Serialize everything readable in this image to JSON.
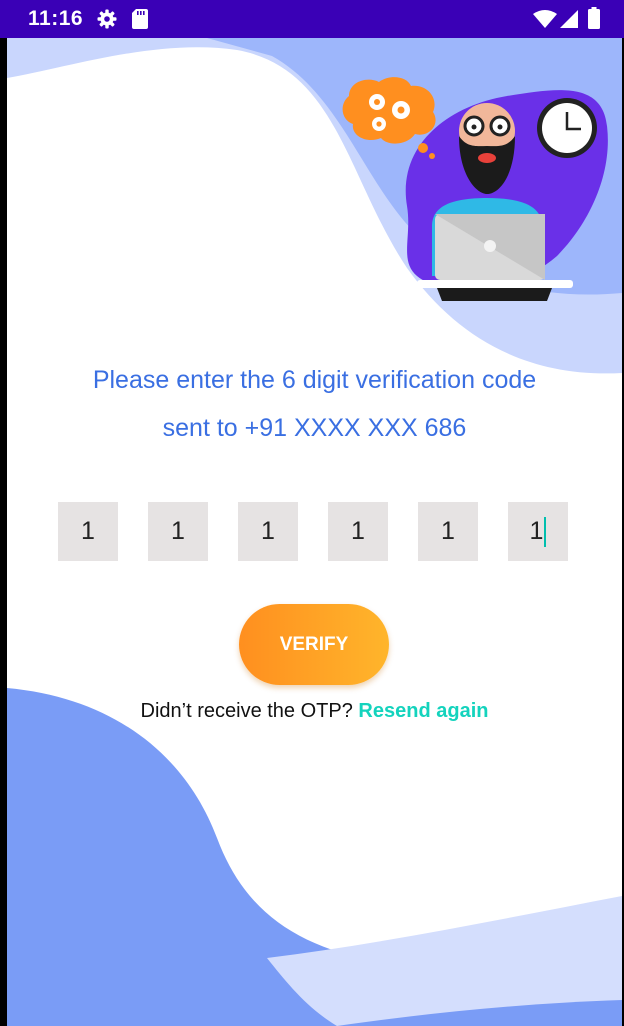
{
  "status_bar": {
    "time": "11:16",
    "icons": [
      "gear-icon",
      "sd-card-icon",
      "wifi-icon",
      "signal-icon",
      "battery-icon"
    ],
    "background": "#3a00b6"
  },
  "verification": {
    "line1": "Please enter the 6 digit verification code",
    "line2": "sent to +91 XXXX XXX 686"
  },
  "otp": {
    "digits": [
      "1",
      "1",
      "1",
      "1",
      "1",
      "1"
    ]
  },
  "verify_button": {
    "label": "VERIFY"
  },
  "resend": {
    "prompt": "Didn’t receive the OTP?",
    "link": "Resend again"
  },
  "colors": {
    "accent_blue": "#3a6fe2",
    "button_orange": "#ff9a22",
    "link_teal": "#14d3bd",
    "wave_blue": "#7a9cf6",
    "wave_light": "#c9d6fd"
  }
}
